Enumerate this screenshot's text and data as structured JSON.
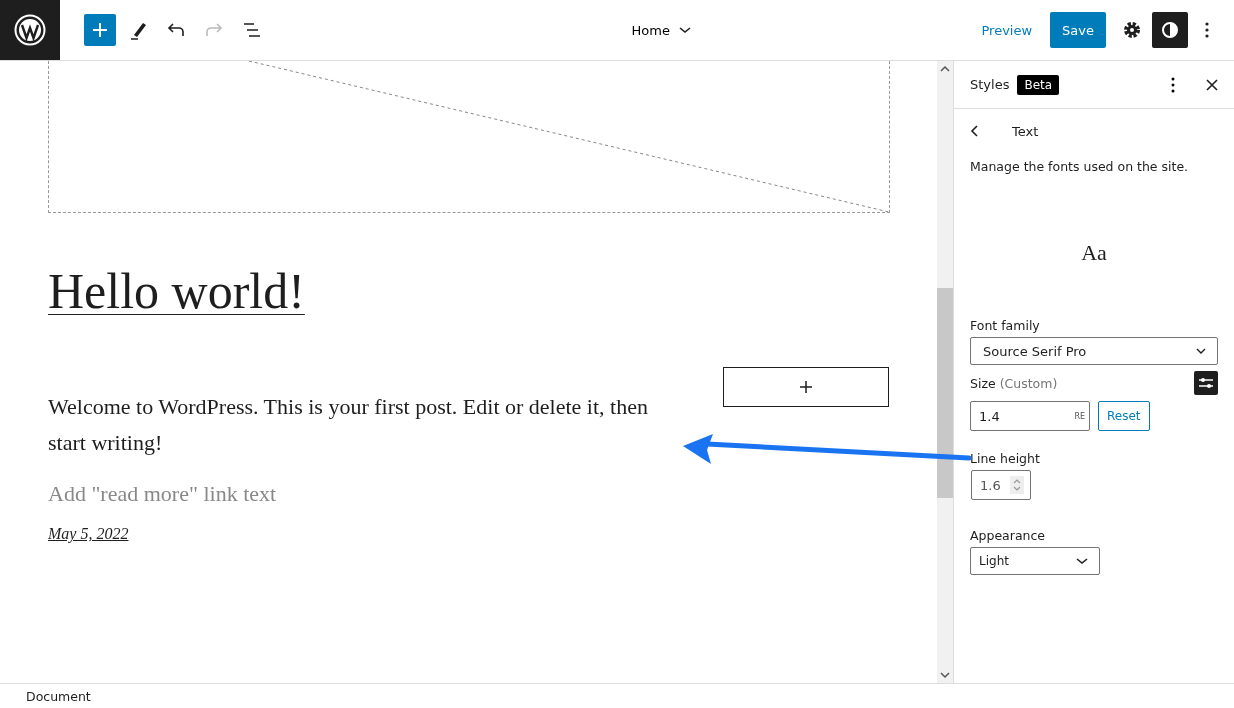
{
  "toolbar": {
    "tools": [
      {
        "kind": "inserter",
        "disabled": false
      },
      {
        "kind": "pen",
        "disabled": false
      },
      {
        "kind": "undo",
        "disabled": false
      },
      {
        "kind": "redo",
        "disabled": true
      },
      {
        "kind": "list-view",
        "disabled": false
      }
    ],
    "document_title": "Home",
    "preview": "Preview",
    "save": "Save",
    "styles_selected": true
  },
  "canvas": {
    "heading": "Hello world!",
    "paragraph": "Welcome to WordPress. This is your first post. Edit or delete it, then start writing!",
    "read_more_placeholder": "Add \"read more\" link text",
    "date": "May 5, 2022"
  },
  "sidebar": {
    "title": "Styles",
    "badge": "Beta",
    "section": "Text",
    "description": "Manage the fonts used on the site.",
    "preview": "Aa",
    "font_family": {
      "label": "Font family",
      "value": "Source Serif Pro"
    },
    "size": {
      "label": "Size",
      "note": "(Custom)",
      "value": "1.4",
      "unit": "RE",
      "reset": "Reset"
    },
    "line_height": {
      "label": "Line height",
      "value": "1.6"
    },
    "appearance": {
      "label": "Appearance",
      "value": "Light"
    }
  },
  "status_bar": {
    "breadcrumb": "Document"
  }
}
